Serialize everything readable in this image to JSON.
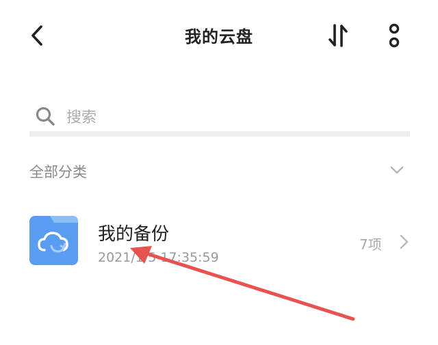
{
  "header": {
    "title": "我的云盘",
    "back_icon": "chevron-left-icon",
    "sort_icon": "sort-arrows-icon",
    "more_icon": "more-vertical-icon"
  },
  "search": {
    "placeholder": "搜索",
    "icon": "search-icon"
  },
  "category": {
    "label": "全部分类",
    "icon": "chevron-down-icon"
  },
  "folders": [
    {
      "name": "我的备份",
      "time": "2021/1/5 17:35:59",
      "count": "7项",
      "icon": "cloud-sync-folder-icon"
    }
  ],
  "colors": {
    "folder_blue": "#5a9cf2",
    "folder_tab": "#8ebdf7",
    "annotation_red": "#e8524f",
    "text_dark": "#222222",
    "text_gray": "#999999"
  }
}
